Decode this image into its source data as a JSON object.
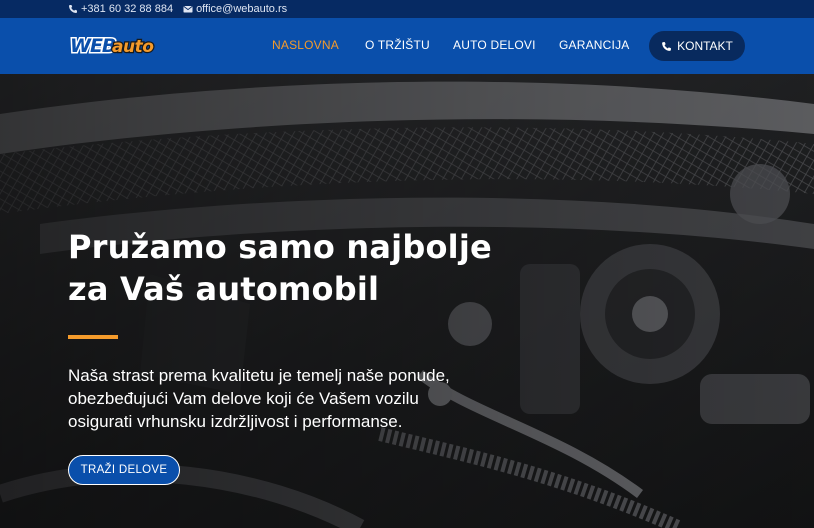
{
  "topbar": {
    "phone": "+381 60 32 88 884",
    "email": "office@webauto.rs",
    "phone_icon": "phone-icon",
    "email_icon": "envelope-icon"
  },
  "nav": {
    "logo_text": "WEBauto",
    "items": [
      {
        "label": "NASLOVNA",
        "active": true
      },
      {
        "label": "O TRŽIŠTU",
        "active": false
      },
      {
        "label": "AUTO DELOVI",
        "active": false
      },
      {
        "label": "GARANCIJA",
        "active": false
      }
    ],
    "contact_label": "KONTAKT",
    "contact_icon": "phone-icon"
  },
  "hero": {
    "title_lines": [
      "Pružamo samo najbolje",
      "za Vaš automobil"
    ],
    "text_lines": [
      "Naša strast prema kvalitetu je temelj naše ponude,",
      "obezbeđujući Vam delove koji će Vašem vozilu",
      "osigurati vrhunsku izdržljivost i performanse."
    ],
    "cta_label": "TRAŽI DELOVE"
  },
  "colors": {
    "topbar": "#062a63",
    "nav": "#0a4fab",
    "accent": "#f59b2b",
    "button_dark": "#082a5e"
  }
}
